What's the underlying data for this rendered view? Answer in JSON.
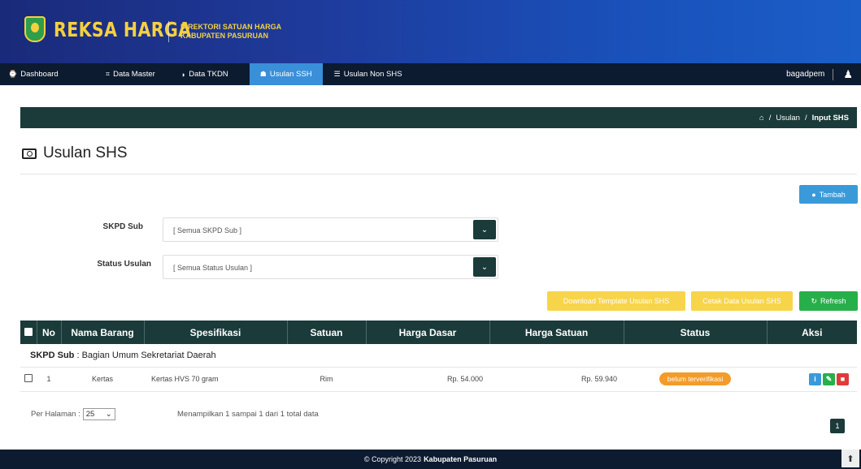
{
  "header": {
    "brand": "REKSA HARGA",
    "subtitle_line1": "DIREKTORI SATUAN HARGA",
    "subtitle_line2": "KABUPATEN PASURUAN"
  },
  "nav": {
    "items": [
      {
        "icon": "⌚",
        "label": "Dashboard"
      },
      {
        "icon": "⌗",
        "label": "Data Master"
      },
      {
        "icon": "◗",
        "label": "Data TKDN"
      },
      {
        "icon": "☗",
        "label": "Usulan SSH"
      },
      {
        "icon": "☰",
        "label": "Usulan Non SHS"
      }
    ],
    "active_index": 3,
    "username": "bagadpem"
  },
  "breadcrumb": {
    "home_icon": "⌂",
    "sep": "/",
    "parent": "Usulan",
    "current": "Input SHS"
  },
  "page": {
    "title": "Usulan SHS"
  },
  "buttons": {
    "tambah": "Tambah",
    "download": "Download Template Usulan SHS",
    "cetak": "Cetak Data Usulan SHS",
    "refresh": "Refresh"
  },
  "filters": {
    "skpd_label": "SKPD Sub",
    "skpd_value": "[ Semua SKPD Sub ]",
    "status_label": "Status Usulan",
    "status_value": "[ Semua Status Usulan ]"
  },
  "table": {
    "headers": [
      "No",
      "Nama Barang",
      "Spesifikasi",
      "Satuan",
      "Harga Dasar",
      "Harga Satuan",
      "Status",
      "Aksi"
    ],
    "group": {
      "label": "SKPD Sub",
      "value": " : Bagian Umum Sekretariat Daerah"
    },
    "rows": [
      {
        "no": "1",
        "nama": "Kertas",
        "spesifikasi": "Kertas HVS 70 gram",
        "satuan": "Rim",
        "harga_dasar": "Rp. 54.000",
        "harga_satuan": "Rp. 59.940",
        "status": "belum terverifikasi"
      }
    ]
  },
  "pagination": {
    "per_page_label": "Per Halaman :",
    "per_page_value": "25",
    "showing": "Menampilkan 1 sampai 1 dari 1 total data",
    "page": "1"
  },
  "footer": {
    "copyright": "© Copyright 2023",
    "org": "Kabupaten Pasuruan"
  },
  "colors": {
    "header_bg": "#1e3a9a",
    "brand": "#f4d03f",
    "nav_bg": "#0c1b30",
    "nav_active": "#3a8fd9",
    "teal_dark": "#1b3a3a",
    "btn_blue": "#3a9ad9",
    "btn_yellow": "#f7d44a",
    "btn_green": "#27b04a",
    "badge_orange": "#f39c2a",
    "btn_red": "#e03a3a"
  }
}
